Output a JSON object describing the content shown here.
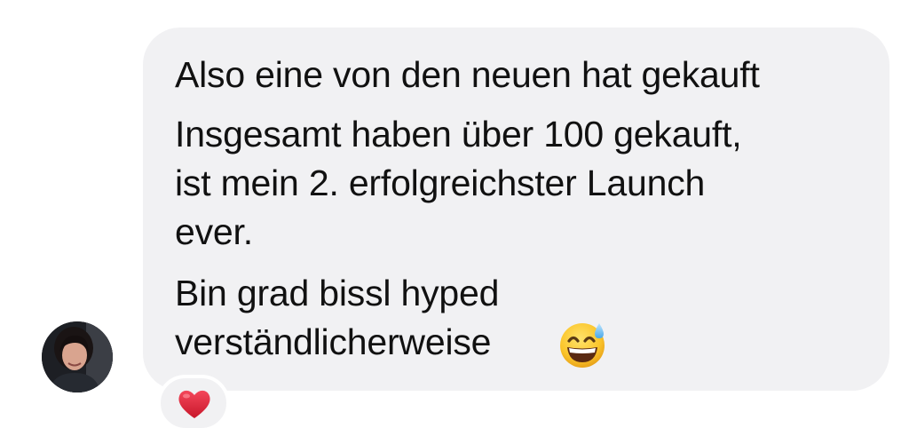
{
  "message": {
    "lines": [
      "Also eine von den neuen hat gekauft",
      "Insgesamt haben über 100 gekauft,",
      "ist mein 2. erfolgreichster Launch",
      "ever.",
      "Bin grad bissl hyped",
      "verständlicherweise"
    ],
    "trailing_emoji": "grinning-face-with-sweat-emoji"
  },
  "reaction": {
    "icon": "red-heart-icon",
    "color": "#e0283a"
  },
  "colors": {
    "bubble": "#f1f1f3",
    "text": "#111111",
    "background": "#ffffff"
  }
}
